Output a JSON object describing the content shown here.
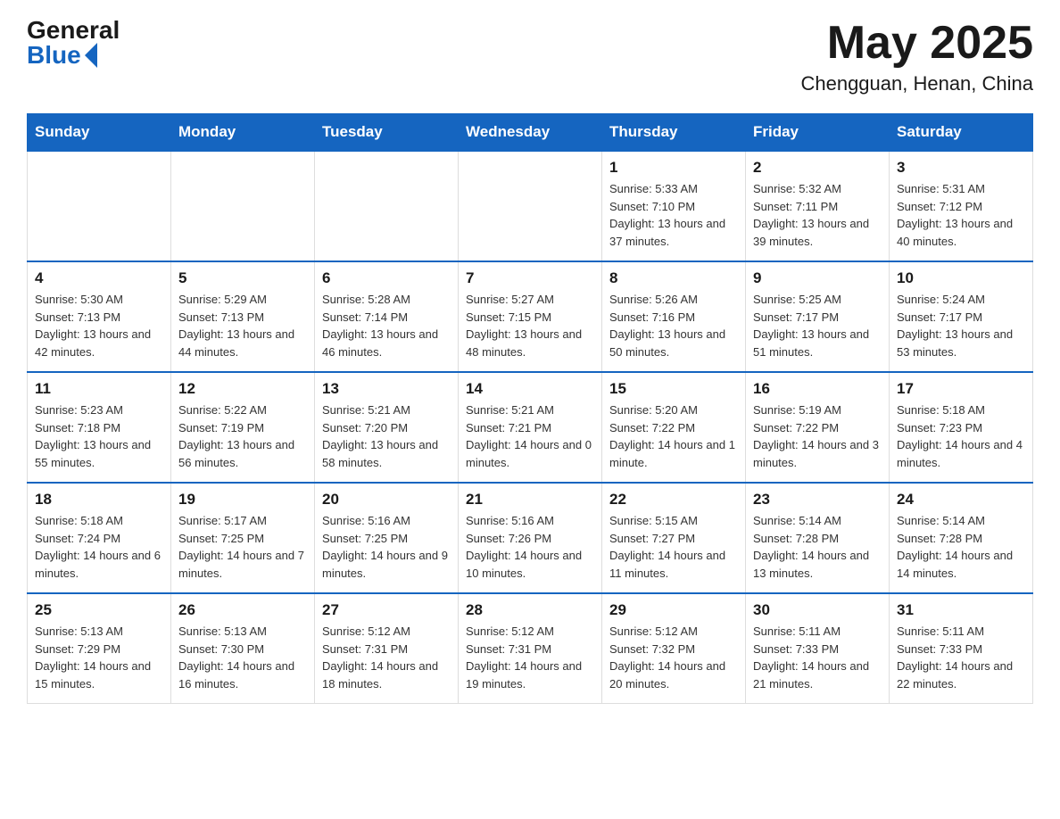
{
  "header": {
    "logo": {
      "general": "General",
      "blue": "Blue",
      "triangle": true
    },
    "title": "May 2025",
    "location": "Chengguan, Henan, China"
  },
  "calendar": {
    "days_of_week": [
      "Sunday",
      "Monday",
      "Tuesday",
      "Wednesday",
      "Thursday",
      "Friday",
      "Saturday"
    ],
    "weeks": [
      [
        {
          "day": "",
          "info": ""
        },
        {
          "day": "",
          "info": ""
        },
        {
          "day": "",
          "info": ""
        },
        {
          "day": "",
          "info": ""
        },
        {
          "day": "1",
          "info": "Sunrise: 5:33 AM\nSunset: 7:10 PM\nDaylight: 13 hours and 37 minutes."
        },
        {
          "day": "2",
          "info": "Sunrise: 5:32 AM\nSunset: 7:11 PM\nDaylight: 13 hours and 39 minutes."
        },
        {
          "day": "3",
          "info": "Sunrise: 5:31 AM\nSunset: 7:12 PM\nDaylight: 13 hours and 40 minutes."
        }
      ],
      [
        {
          "day": "4",
          "info": "Sunrise: 5:30 AM\nSunset: 7:13 PM\nDaylight: 13 hours and 42 minutes."
        },
        {
          "day": "5",
          "info": "Sunrise: 5:29 AM\nSunset: 7:13 PM\nDaylight: 13 hours and 44 minutes."
        },
        {
          "day": "6",
          "info": "Sunrise: 5:28 AM\nSunset: 7:14 PM\nDaylight: 13 hours and 46 minutes."
        },
        {
          "day": "7",
          "info": "Sunrise: 5:27 AM\nSunset: 7:15 PM\nDaylight: 13 hours and 48 minutes."
        },
        {
          "day": "8",
          "info": "Sunrise: 5:26 AM\nSunset: 7:16 PM\nDaylight: 13 hours and 50 minutes."
        },
        {
          "day": "9",
          "info": "Sunrise: 5:25 AM\nSunset: 7:17 PM\nDaylight: 13 hours and 51 minutes."
        },
        {
          "day": "10",
          "info": "Sunrise: 5:24 AM\nSunset: 7:17 PM\nDaylight: 13 hours and 53 minutes."
        }
      ],
      [
        {
          "day": "11",
          "info": "Sunrise: 5:23 AM\nSunset: 7:18 PM\nDaylight: 13 hours and 55 minutes."
        },
        {
          "day": "12",
          "info": "Sunrise: 5:22 AM\nSunset: 7:19 PM\nDaylight: 13 hours and 56 minutes."
        },
        {
          "day": "13",
          "info": "Sunrise: 5:21 AM\nSunset: 7:20 PM\nDaylight: 13 hours and 58 minutes."
        },
        {
          "day": "14",
          "info": "Sunrise: 5:21 AM\nSunset: 7:21 PM\nDaylight: 14 hours and 0 minutes."
        },
        {
          "day": "15",
          "info": "Sunrise: 5:20 AM\nSunset: 7:22 PM\nDaylight: 14 hours and 1 minute."
        },
        {
          "day": "16",
          "info": "Sunrise: 5:19 AM\nSunset: 7:22 PM\nDaylight: 14 hours and 3 minutes."
        },
        {
          "day": "17",
          "info": "Sunrise: 5:18 AM\nSunset: 7:23 PM\nDaylight: 14 hours and 4 minutes."
        }
      ],
      [
        {
          "day": "18",
          "info": "Sunrise: 5:18 AM\nSunset: 7:24 PM\nDaylight: 14 hours and 6 minutes."
        },
        {
          "day": "19",
          "info": "Sunrise: 5:17 AM\nSunset: 7:25 PM\nDaylight: 14 hours and 7 minutes."
        },
        {
          "day": "20",
          "info": "Sunrise: 5:16 AM\nSunset: 7:25 PM\nDaylight: 14 hours and 9 minutes."
        },
        {
          "day": "21",
          "info": "Sunrise: 5:16 AM\nSunset: 7:26 PM\nDaylight: 14 hours and 10 minutes."
        },
        {
          "day": "22",
          "info": "Sunrise: 5:15 AM\nSunset: 7:27 PM\nDaylight: 14 hours and 11 minutes."
        },
        {
          "day": "23",
          "info": "Sunrise: 5:14 AM\nSunset: 7:28 PM\nDaylight: 14 hours and 13 minutes."
        },
        {
          "day": "24",
          "info": "Sunrise: 5:14 AM\nSunset: 7:28 PM\nDaylight: 14 hours and 14 minutes."
        }
      ],
      [
        {
          "day": "25",
          "info": "Sunrise: 5:13 AM\nSunset: 7:29 PM\nDaylight: 14 hours and 15 minutes."
        },
        {
          "day": "26",
          "info": "Sunrise: 5:13 AM\nSunset: 7:30 PM\nDaylight: 14 hours and 16 minutes."
        },
        {
          "day": "27",
          "info": "Sunrise: 5:12 AM\nSunset: 7:31 PM\nDaylight: 14 hours and 18 minutes."
        },
        {
          "day": "28",
          "info": "Sunrise: 5:12 AM\nSunset: 7:31 PM\nDaylight: 14 hours and 19 minutes."
        },
        {
          "day": "29",
          "info": "Sunrise: 5:12 AM\nSunset: 7:32 PM\nDaylight: 14 hours and 20 minutes."
        },
        {
          "day": "30",
          "info": "Sunrise: 5:11 AM\nSunset: 7:33 PM\nDaylight: 14 hours and 21 minutes."
        },
        {
          "day": "31",
          "info": "Sunrise: 5:11 AM\nSunset: 7:33 PM\nDaylight: 14 hours and 22 minutes."
        }
      ]
    ]
  }
}
